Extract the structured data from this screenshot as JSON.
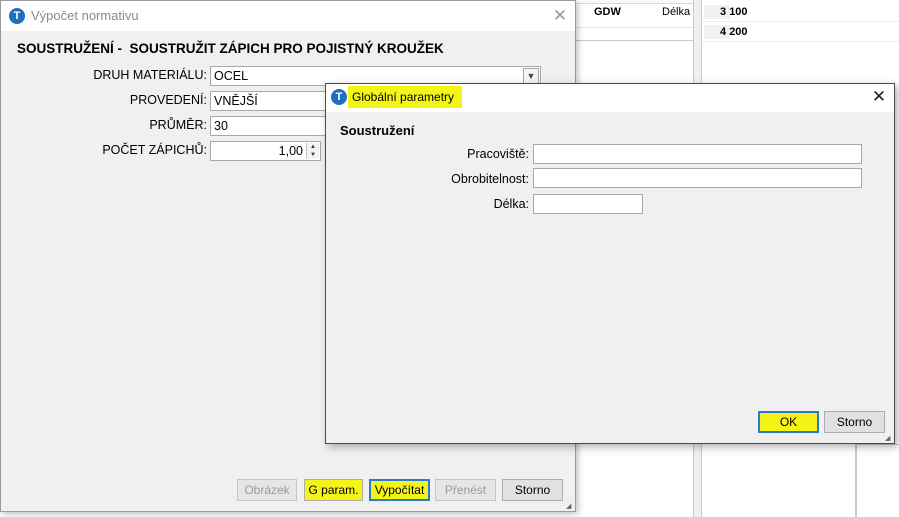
{
  "background": {
    "table_row": {
      "code": "GDW",
      "length": "Délka"
    },
    "list_rows": [
      {
        "index": "3",
        "value": "100"
      },
      {
        "index": "4",
        "value": "200"
      }
    ]
  },
  "calc_window": {
    "title": "Výpočet normativu",
    "logo_letter": "T",
    "close_glyph": "✕",
    "heading": "SOUSTRUŽENÍ -  SOUSTRUŽIT ZÁPICH PRO POJISTNÝ KROUŽEK",
    "fields": {
      "material": {
        "label": "DRUH MATERIÁLU:",
        "value": "OCEL"
      },
      "provedeni": {
        "label": "PROVEDENÍ:",
        "value": "VNĚJŠÍ"
      },
      "prumer": {
        "label": "PRŮMĚR:",
        "value": "30"
      },
      "pocet": {
        "label": "POČET ZÁPICHŮ:",
        "value": "1,00"
      }
    },
    "buttons": {
      "obrazek": "Obrázek",
      "g_param": "G param.",
      "vypocitat": "Vypočítat",
      "prenest": "Přenést",
      "storno": "Storno"
    },
    "highlight_color": "#f4f417"
  },
  "params_window": {
    "title": "Globální parametry",
    "logo_letter": "T",
    "close_glyph": "✕",
    "section": "Soustružení",
    "fields": {
      "pracoviste": {
        "label": "Pracoviště:",
        "value": ""
      },
      "obrobitelnost": {
        "label": "Obrobitelnost:",
        "value": ""
      },
      "delka": {
        "label": "Délka:",
        "value": ""
      }
    },
    "buttons": {
      "ok": "OK",
      "storno": "Storno"
    }
  }
}
